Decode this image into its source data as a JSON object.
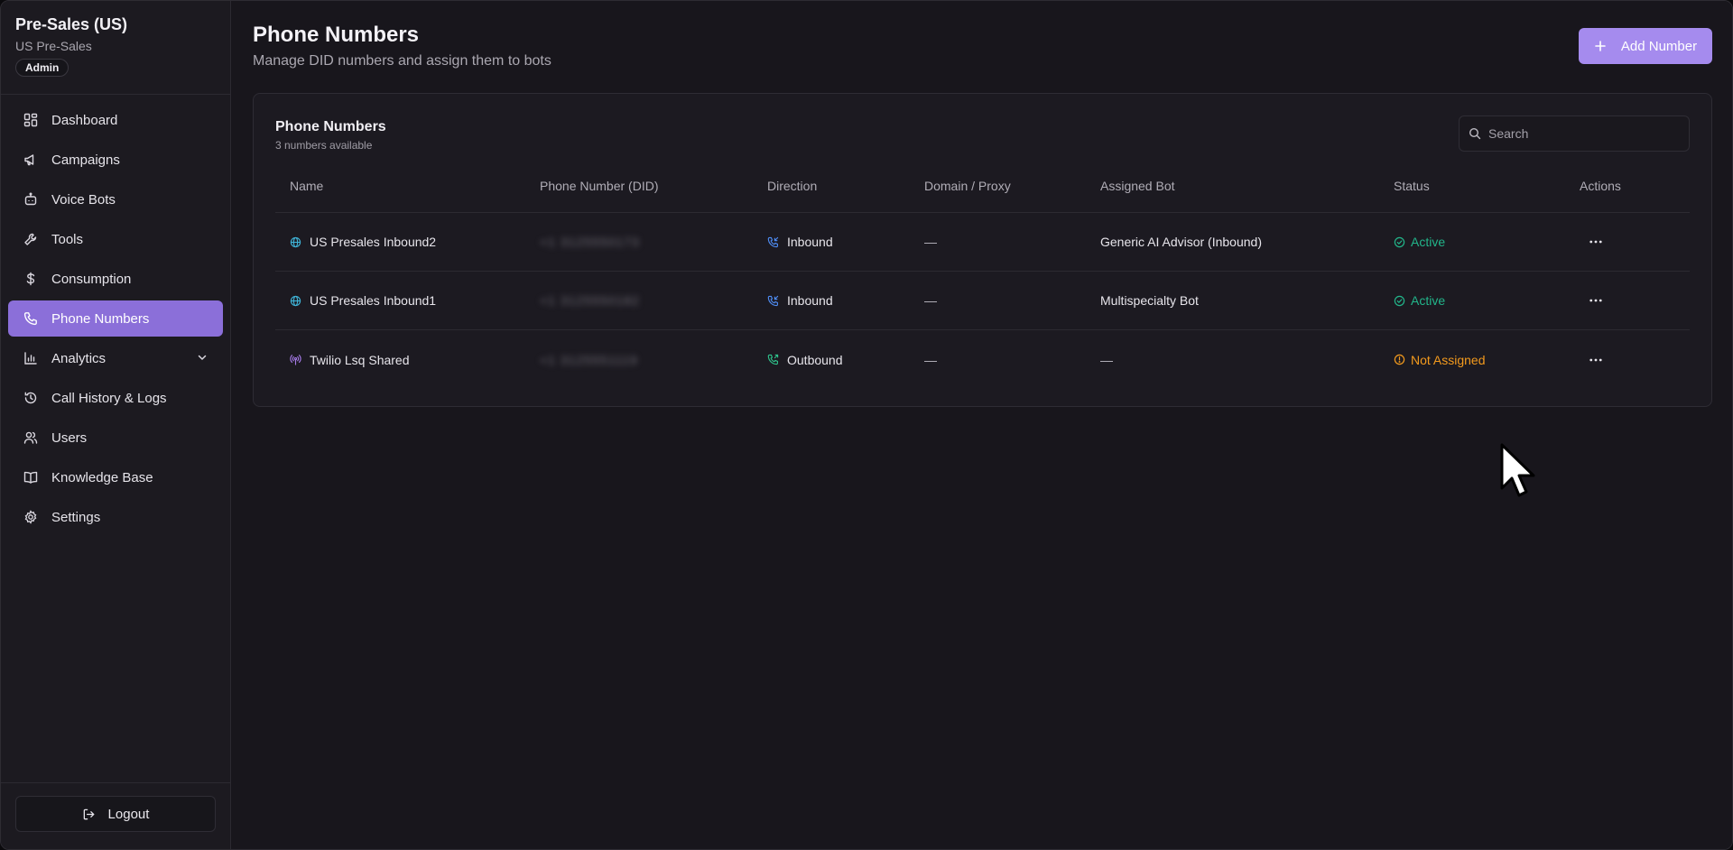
{
  "sidebar": {
    "org_name": "Pre-Sales (US)",
    "org_sub": "US Pre-Sales",
    "role": "Admin",
    "items": [
      {
        "label": "Dashboard",
        "icon": "dashboard-icon"
      },
      {
        "label": "Campaigns",
        "icon": "megaphone-icon"
      },
      {
        "label": "Voice Bots",
        "icon": "bot-icon"
      },
      {
        "label": "Tools",
        "icon": "wrench-icon"
      },
      {
        "label": "Consumption",
        "icon": "dollar-icon"
      },
      {
        "label": "Phone Numbers",
        "icon": "phone-icon",
        "active": true
      },
      {
        "label": "Analytics",
        "icon": "bar-chart-icon",
        "expandable": true
      },
      {
        "label": "Call History & Logs",
        "icon": "history-icon"
      },
      {
        "label": "Users",
        "icon": "users-icon"
      },
      {
        "label": "Knowledge Base",
        "icon": "book-icon"
      },
      {
        "label": "Settings",
        "icon": "gear-icon"
      }
    ],
    "logout_label": "Logout"
  },
  "header": {
    "title": "Phone Numbers",
    "subtitle": "Manage DID numbers and assign them to bots",
    "add_label": "Add Number"
  },
  "card": {
    "title": "Phone Numbers",
    "subtitle": "3 numbers available",
    "search_placeholder": "Search"
  },
  "table": {
    "columns": [
      "Name",
      "Phone Number (DID)",
      "Direction",
      "Domain / Proxy",
      "Assigned Bot",
      "Status",
      "Actions"
    ],
    "rows": [
      {
        "name": "US Presales Inbound2",
        "name_icon": "globe-icon",
        "phone": "+1 3125550173",
        "direction": "Inbound",
        "direction_icon": "phone-incoming-icon",
        "domain": "—",
        "bot": "Generic AI Advisor (Inbound)",
        "status": "Active",
        "status_type": "active"
      },
      {
        "name": "US Presales Inbound1",
        "name_icon": "globe-icon",
        "phone": "+1 3125550182",
        "direction": "Inbound",
        "direction_icon": "phone-incoming-icon",
        "domain": "—",
        "bot": "Multispecialty Bot",
        "status": "Active",
        "status_type": "active"
      },
      {
        "name": "Twilio Lsq Shared",
        "name_icon": "antenna-icon",
        "phone": "+1 3125551119",
        "direction": "Outbound",
        "direction_icon": "phone-outgoing-icon",
        "domain": "—",
        "bot": "—",
        "status": "Not Assigned",
        "status_type": "warn"
      }
    ]
  },
  "colors": {
    "accent": "#8b6fd9",
    "button": "#a58bee",
    "active": "#22b58a",
    "warning": "#f39a1d",
    "inbound": "#4f8df5",
    "outbound": "#2fc48d"
  }
}
